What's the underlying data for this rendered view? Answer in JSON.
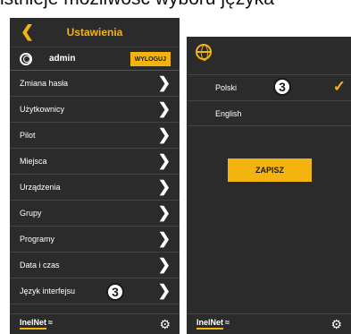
{
  "caption": "istnieje możliwość wyboru języka",
  "settings": {
    "title": "Ustawienia",
    "user": {
      "name": "admin",
      "logout_label": "WYLOGUJ"
    },
    "menu": [
      {
        "label": "Zmiana hasła"
      },
      {
        "label": "Użytkownicy"
      },
      {
        "label": "Pilot"
      },
      {
        "label": "Miejsca"
      },
      {
        "label": "Urządzenia"
      },
      {
        "label": "Grupy"
      },
      {
        "label": "Programy"
      },
      {
        "label": "Data i czas"
      },
      {
        "label": "Język interfejsu"
      }
    ],
    "footer": {
      "logo_text": "InelNet"
    }
  },
  "language": {
    "options": [
      {
        "label": "Polski",
        "selected": true
      },
      {
        "label": "English",
        "selected": false
      }
    ],
    "save_label": "ZAPISZ",
    "footer": {
      "logo_text": "InelNet"
    }
  },
  "badges": {
    "menu_badge": "3",
    "lang_badge": "3"
  },
  "colors": {
    "accent": "#f4b410",
    "panel_bg": "#2b2b2b"
  }
}
